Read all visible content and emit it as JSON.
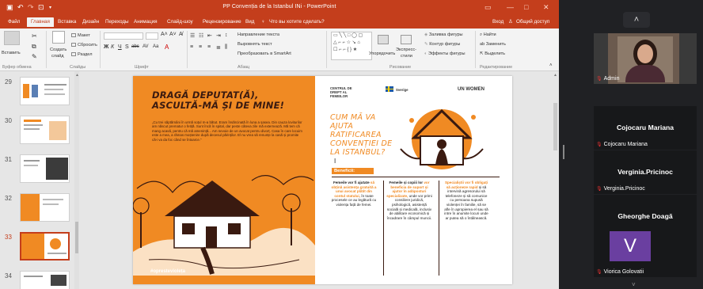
{
  "window": {
    "title": "PP Convenția de la Istanbul INi - PowerPoint",
    "sign_in": "Вход",
    "share": "Общий доступ"
  },
  "menu": {
    "file": "Файл",
    "tabs": [
      "Главная",
      "Вставка",
      "Дизайн",
      "Переходы",
      "Анимация",
      "Слайд-шоу",
      "Рецензирование",
      "Вид"
    ],
    "tell_me": "Что вы хотите сделать?"
  },
  "ribbon": {
    "paste": "Вставить",
    "clipboard": "Буфер обмена",
    "new_slide_1": "Создать",
    "new_slide_2": "слайд",
    "layout": "Макет",
    "reset": "Сбросить",
    "section": "Раздел",
    "slides": "Слайды",
    "font": "Шрифт",
    "paragraph": "Абзац",
    "text_direction": "Направление текста",
    "align_text": "Выровнять текст",
    "smartart": "Преобразовать в SmartArt",
    "arrange": "Упорядочить",
    "quick_styles_1": "Экспресс-",
    "quick_styles_2": "стили",
    "drawing": "Рисование",
    "shape_fill": "Заливка фигуры",
    "shape_outline": "Контур фигуры",
    "shape_effects": "Эффекты фигуры",
    "find": "Найти",
    "replace": "Заменить",
    "select": "Выделить",
    "editing": "Редактирование"
  },
  "thumbnails": [
    {
      "num": "29",
      "selected": false
    },
    {
      "num": "30",
      "selected": false
    },
    {
      "num": "31",
      "selected": false
    },
    {
      "num": "32",
      "selected": false
    },
    {
      "num": "33",
      "selected": true
    },
    {
      "num": "34",
      "selected": false
    }
  ],
  "slide": {
    "title_line1": "DRAGĂ DEPUTAT(Ă),",
    "title_line2": "ASCULTĂ-MĂ ȘI DE MINE!",
    "quote": "„Cu trei săptămâni în urmă soțul m-a bătut. Eram însărcinată în luna a șasea. Din cauza loviturilor am născut prematur o fetiță. Sunt încă în spital, dar peste câteva zile mă externează. Mă tem că mang acasă, pentru că mă amenință... Am nevoie de un avocat pentru divorț. Casa în care locuim este a mea, a rămas moștenire după decesul părinților. El nu vrea să renunțe la casă și promite că-i va da foc când se întoarce.”",
    "hashtag": "#oprestevioleța",
    "logo1": "CENTRUL DE DREPT AL FEMEILOR",
    "logo2_line1": "Sverige",
    "logo3": "UN WOMEN",
    "ask": "CUM MĂ VA AJUTA RATIFICAREA CONVENȚIEI DE LA ISTANBUL?",
    "benefits": "Beneficii:",
    "col1": {
      "a": "Femeile vor fi ajutate ",
      "b": "să obțină asistența gratuită a unui avocat plătit din contul statului,",
      "c": " în toate procesele ce au legătură cu violența față de femei."
    },
    "col2": {
      "a": "Femeile și copiii lor ",
      "b": "vor beneficia de suport și ajutor în adăposturi specializate,",
      "c": " unde vor primi consiliere juridică, psihologică, asistență socială și medicală, inclusiv de abilitare economică și încadrare în câmpul muncii."
    },
    "col3": {
      "a": "Specialiștii vor fi obligați să acționeze rapid",
      "b": " și să intervină agresorului să telefoneze și să comunice cu persoana supusă violenței în familie, să se afle în apropierea el sau să intre în anumite locuri unde ar putea să o întâlnească."
    }
  },
  "participants": [
    {
      "name": "Admin",
      "type": "video"
    },
    {
      "name": "Cojocaru Mariana",
      "type": "name"
    },
    {
      "name": "Verginia.Pricinoc",
      "type": "name"
    },
    {
      "name": "Gheorghe Doagă",
      "type": "name"
    },
    {
      "name": "Viorica Golovatii",
      "initial": "V",
      "type": "avatar"
    }
  ],
  "colors": {
    "accent": "#c43e1c",
    "slide_orange": "#f08a23"
  }
}
